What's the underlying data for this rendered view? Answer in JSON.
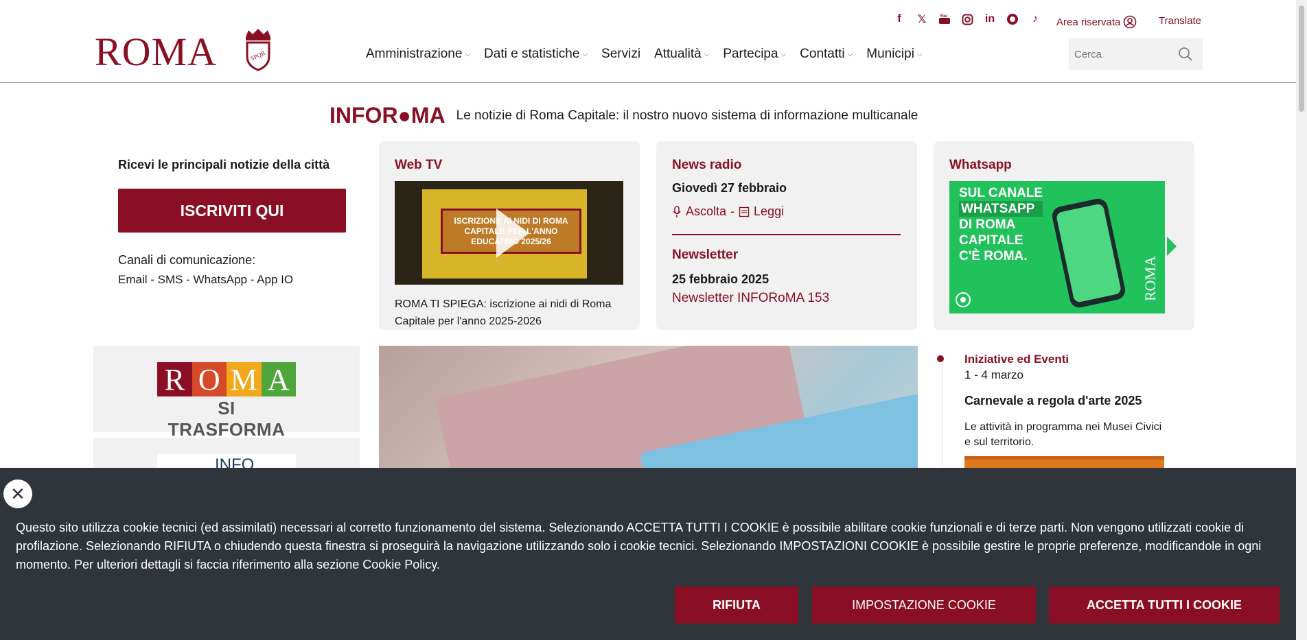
{
  "header": {
    "logo_text": "ROMA",
    "social_icons": [
      "facebook-icon",
      "x-icon",
      "youtube-icon",
      "instagram-icon",
      "linkedin-icon",
      "whatsapp-icon",
      "tiktok-icon"
    ],
    "area_riservata": "Area riservata",
    "translate": "Translate",
    "nav": [
      {
        "label": "Amministrazione",
        "dropdown": true
      },
      {
        "label": "Dati e statistiche",
        "dropdown": true
      },
      {
        "label": "Servizi",
        "dropdown": false
      },
      {
        "label": "Attualità",
        "dropdown": true
      },
      {
        "label": "Partecipa",
        "dropdown": true
      },
      {
        "label": "Contatti",
        "dropdown": true
      },
      {
        "label": "Municipi",
        "dropdown": true
      }
    ],
    "search_placeholder": "Cerca"
  },
  "inforoma": {
    "logo": "INFOR●MA",
    "tagline": "Le notizie di Roma Capitale: il nostro nuovo sistema di informazione multicanale"
  },
  "subscribe": {
    "title": "Ricevi le principali notizie della città",
    "button": "ISCRIVITI QUI",
    "channels_label": "Canali di comunicazione:",
    "channels": "Email - SMS - WhatsApp - App IO"
  },
  "webtv": {
    "title": "Web TV",
    "video_overlay": "ISCRIZIONE AI NIDI DI ROMA CAPITALE PER L'ANNO EDUCATIVO 2025/26",
    "caption": "ROMA TI SPIEGA: iscrizione ai nidi di Roma Capitale per l'anno 2025-2026"
  },
  "news": {
    "title": "News radio",
    "date": "Giovedì 27 febbraio",
    "ascolta": "Ascolta",
    "separator": "-",
    "leggi": "Leggi",
    "newsletter_title": "Newsletter",
    "newsletter_date": "25 febbraio 2025",
    "newsletter_link": "Newsletter INFORoMA 153"
  },
  "whatsapp": {
    "title": "Whatsapp",
    "banner_lines": [
      "SUL CANALE",
      "WHATSAPP",
      "DI ROMA",
      "CAPITALE",
      "C'È ROMA."
    ],
    "banner_roma": "ROMA"
  },
  "roma_si_trasforma": {
    "letters": [
      "R",
      "O",
      "M",
      "A"
    ],
    "colors": [
      "#8a0f24",
      "#d64a2a",
      "#f2a81d",
      "#4fa63d"
    ],
    "subtitle": "SI TRASFORMA"
  },
  "info_box": {
    "label": "INFO"
  },
  "event": {
    "category": "Iniziative ed Eventi",
    "date": "1 - 4 marzo",
    "title": "Carnevale a regola d'arte 2025",
    "description": "Le attività in programma nei Musei Civici e sul territorio."
  },
  "cookie": {
    "text": "Questo sito utilizza cookie tecnici (ed assimilati) necessari al corretto funzionamento del sistema. Selezionando ACCETTA TUTTI I COOKIE è possibile abilitare cookie funzionali e di terze parti. Non vengono utilizzati cookie di profilazione. Selezionando RIFIUTA o chiudendo questa finestra si proseguirà la navigazione utilizzando solo i cookie tecnici. Selezionando IMPOSTAZIONI COOKIE è possibile gestire le proprie preferenze, modificandole in ogni momento. Per ulteriori dettagli si faccia riferimento alla sezione  Cookie Policy.",
    "btn_rifiuta": "RIFIUTA",
    "btn_impostazioni": "IMPOSTAZIONE COOKIE",
    "btn_accetta": "ACCETTA TUTTI I COOKIE"
  },
  "colors": {
    "brand": "#8a0f24",
    "cookie_bg": "#2f353b",
    "whatsapp_green": "#21c15b"
  }
}
